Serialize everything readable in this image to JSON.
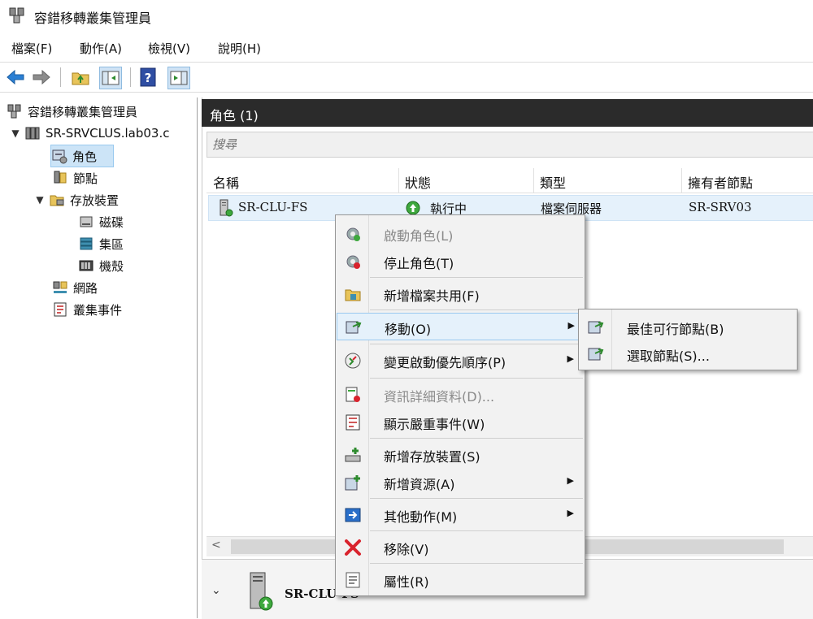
{
  "window": {
    "title": "容錯移轉叢集管理員"
  },
  "menubar": {
    "items": [
      "檔案(F)",
      "動作(A)",
      "檢視(V)",
      "說明(H)"
    ]
  },
  "tree": {
    "root": "容錯移轉叢集管理員",
    "cluster": "SR-SRVCLUS.lab03.c",
    "roles": "角色",
    "nodes": "節點",
    "storage": "存放裝置",
    "disks": "磁碟",
    "pools": "集區",
    "enclosures": "機殼",
    "networks": "網路",
    "events": "叢集事件"
  },
  "pane": {
    "header": "角色 (1)",
    "search_placeholder": "搜尋",
    "columns": [
      "名稱",
      "狀態",
      "類型",
      "擁有者節點"
    ],
    "rows": [
      {
        "name": "SR-CLU-FS",
        "status": "執行中",
        "type": "檔案伺服器",
        "owner": "SR-SRV03"
      }
    ],
    "detail_name": "SR-CLU-FS"
  },
  "context_menu": {
    "start_role": "啟動角色(L)",
    "stop_role": "停止角色(T)",
    "add_share": "新增檔案共用(F)",
    "move": "移動(O)",
    "change_priority": "變更啟動優先順序(P)",
    "info_details": "資訊詳細資料(D)...",
    "show_critical": "顯示嚴重事件(W)",
    "add_storage": "新增存放裝置(S)",
    "add_resource": "新增資源(A)",
    "more_actions": "其他動作(M)",
    "remove": "移除(V)",
    "properties": "屬性(R)"
  },
  "submenu": {
    "best_node": "最佳可行節點(B)",
    "select_node": "選取節點(S)..."
  },
  "colors": {
    "header_bg": "#2b2b2b",
    "selection": "#cce4f7",
    "hover": "#e5f1fb",
    "remove_red": "#d9232d"
  }
}
